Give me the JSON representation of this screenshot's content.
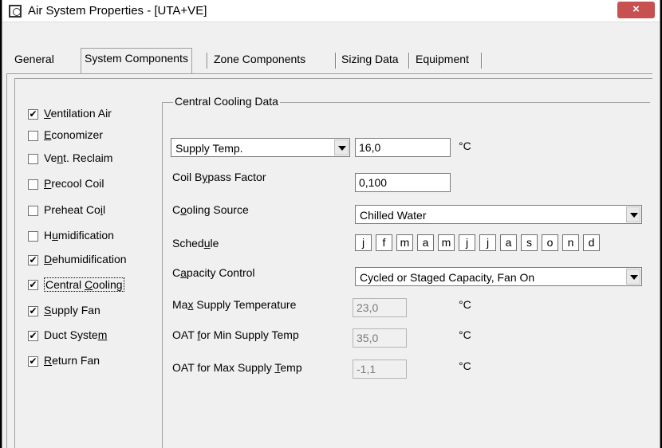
{
  "window": {
    "title": "Air System Properties - [UTA+VE]",
    "close_glyph": "×"
  },
  "tabs": [
    "General",
    "System Components",
    "Zone Components",
    "Sizing Data",
    "Equipment"
  ],
  "checkboxes": [
    {
      "pre": "",
      "u": "V",
      "post": "entilation Air",
      "checked": true
    },
    {
      "pre": "",
      "u": "E",
      "post": "conomizer",
      "checked": false
    },
    {
      "pre": "Ve",
      "u": "n",
      "post": "t. Reclaim",
      "checked": false
    },
    {
      "pre": "",
      "u": "P",
      "post": "recool Coil",
      "checked": false
    },
    {
      "pre": "Preheat Co",
      "u": "i",
      "post": "l",
      "checked": false
    },
    {
      "pre": "H",
      "u": "u",
      "post": "midification",
      "checked": false
    },
    {
      "pre": "",
      "u": "D",
      "post": "ehumidification",
      "checked": true
    },
    {
      "pre": "Central ",
      "u": "C",
      "post": "ooling",
      "checked": true
    },
    {
      "pre": "",
      "u": "S",
      "post": "upply Fan",
      "checked": true
    },
    {
      "pre": "Duct Syste",
      "u": "m",
      "post": "",
      "checked": true
    },
    {
      "pre": "",
      "u": "R",
      "post": "eturn Fan",
      "checked": true
    }
  ],
  "check_glyph": "✔",
  "group_title": "Central Cooling Data",
  "supply_temp": {
    "select": "Supply Temp.",
    "value": "16,0",
    "unit": "°C"
  },
  "coil_bypass": {
    "pre": "Coil B",
    "u": "y",
    "post": "pass Factor",
    "value": "0,100"
  },
  "cooling_source": {
    "pre": "C",
    "u": "o",
    "post": "oling Source",
    "value": "Chilled Water"
  },
  "schedule": {
    "pre": "Sched",
    "u": "u",
    "post": "le",
    "months": [
      "j",
      "f",
      "m",
      "a",
      "m",
      "j",
      "j",
      "a",
      "s",
      "o",
      "n",
      "d"
    ]
  },
  "capacity_control": {
    "pre": "C",
    "u": "a",
    "post": "pacity Control",
    "value": "Cycled or Staged Capacity, Fan On"
  },
  "max_supply": {
    "pre": "Ma",
    "u": "x",
    "post": " Supply Temperature",
    "value": "23,0",
    "unit": "°C"
  },
  "oat_min": {
    "pre": "OAT ",
    "u": "f",
    "post": "or Min Supply Temp",
    "value": "35,0",
    "unit": "°C"
  },
  "oat_max": {
    "pre": "OAT for Max Supply ",
    "u": "T",
    "post": "emp",
    "value": "-1,1",
    "unit": "°C"
  }
}
